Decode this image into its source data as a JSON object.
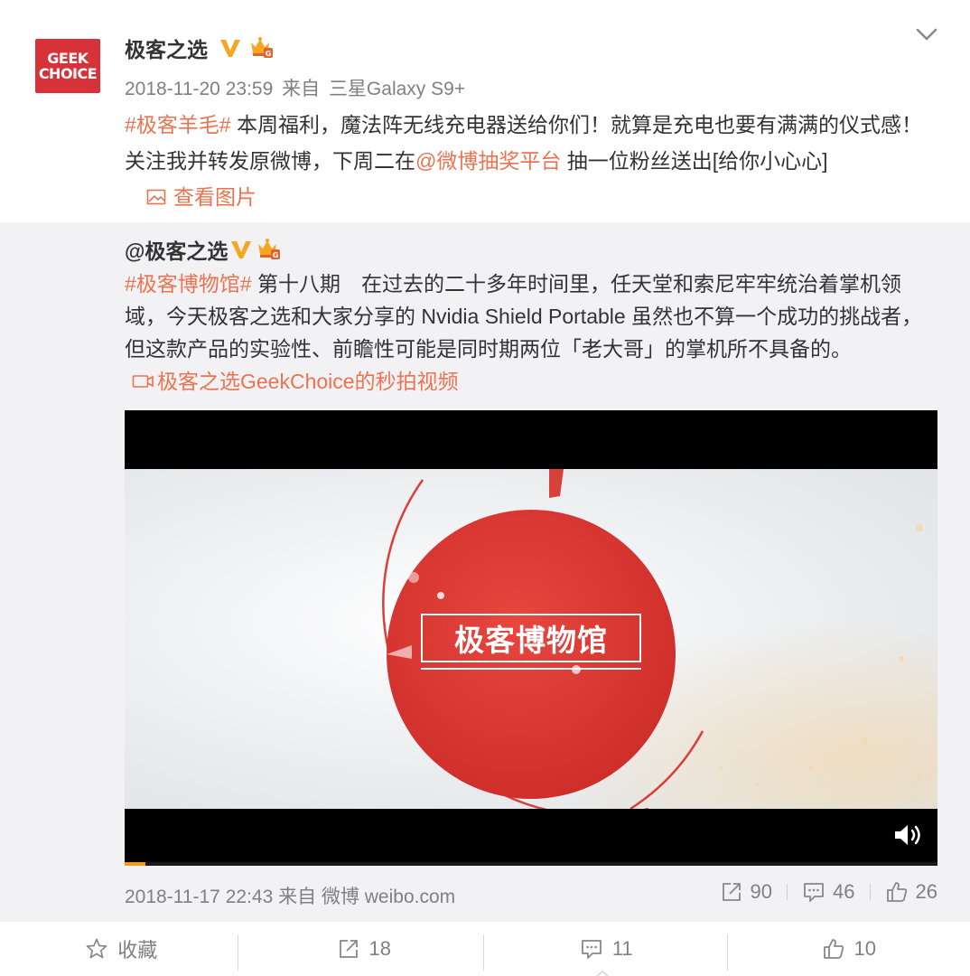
{
  "post": {
    "avatar_text_line1": "GEEK",
    "avatar_text_line2": "CHOICE",
    "author_name": "极客之选",
    "timestamp": "2018-11-20 23:59",
    "source_prefix": "来自",
    "source": "三星Galaxy S9+",
    "hashtag": "#极客羊毛#",
    "text_part1": " 本周福利，魔法阵无线充电器送给你们！就算是充电也要有满满的仪式感！关注我并转发原微博，下周二在",
    "mention": "@微博抽奖平台",
    "text_part2": " 抽一位粉丝送出[给你小心心]",
    "photo_link_label": "查看图片"
  },
  "repost": {
    "author_name": "@极客之选",
    "hashtag": "#极客博物馆#",
    "text": " 第十八期　在过去的二十多年时间里，任天堂和索尼牢牢统治着掌机领域，今天极客之选和大家分享的 Nvidia Shield Portable 虽然也不算一个成功的挑战者，但这款产品的实验性、前瞻性可能是同时期两位「老大哥」的掌机所不具备的。",
    "video_link_label": "极客之选GeekChoice的秒拍视频",
    "video_title": "极客博物馆",
    "video_progress_percent": 2.5,
    "timestamp": "2018-11-17 22:43",
    "source_prefix": "来自",
    "source": "微博 weibo.com",
    "reposts": "90",
    "comments": "46",
    "likes": "26"
  },
  "bottom_bar": {
    "favorite_label": "收藏",
    "repost_count": "18",
    "comment_count": "11",
    "like_count": "10"
  },
  "colors": {
    "link": "#eb7350",
    "verified": "#f5a623",
    "repost_bg": "#f2f2f5",
    "avatar_bg": "#d7323a",
    "progress": "#f39a22"
  }
}
